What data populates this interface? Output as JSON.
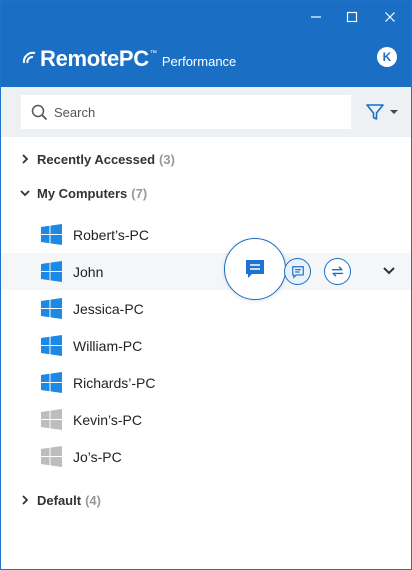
{
  "app": {
    "logo_text": "RemotePC",
    "logo_tm": "™",
    "edition": "Performance",
    "user_initial": "K"
  },
  "search": {
    "placeholder": "Search",
    "value": ""
  },
  "groups": [
    {
      "label": "Recently Accessed",
      "count": "(3)",
      "expanded": false
    },
    {
      "label": "My Computers",
      "count": "(7)",
      "expanded": true
    },
    {
      "label": "Default",
      "count": "(4)",
      "expanded": false
    }
  ],
  "computers": [
    {
      "name": "Robert’s-PC",
      "online": true
    },
    {
      "name": "John",
      "online": true
    },
    {
      "name": "Jessica-PC",
      "online": true
    },
    {
      "name": "William-PC",
      "online": true
    },
    {
      "name": "Richards’-PC",
      "online": true
    },
    {
      "name": "Kevin’s-PC",
      "online": false
    },
    {
      "name": "Jo’s-PC",
      "online": false
    }
  ],
  "colors": {
    "brand": "#1a6fc4",
    "online_icon": "#1e88e5",
    "offline_icon": "#bdbdbd"
  },
  "icons": {
    "minimize": "minimize-icon",
    "maximize": "maximize-icon",
    "close": "close-icon",
    "search": "search-icon",
    "filter": "filter-icon",
    "chat": "chat-icon",
    "transfer": "file-transfer-icon",
    "expand": "chevron-down-icon",
    "os": "windows-icon"
  }
}
